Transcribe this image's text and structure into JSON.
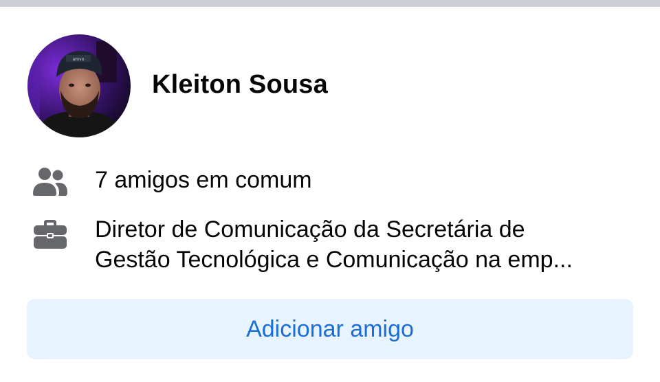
{
  "colors": {
    "divider": "#ccd0d5",
    "text_primary": "#050505",
    "icon_gray": "#65676b",
    "button_bg": "#e7f3ff",
    "button_text": "#1b6ed6"
  },
  "profile": {
    "name": "Kleiton Sousa",
    "avatar_icon": "profile-photo"
  },
  "info": {
    "mutual_friends": {
      "icon": "people-icon",
      "text": "7 amigos em comum"
    },
    "work": {
      "icon": "briefcase-icon",
      "line1": "Diretor de Comunicação da Secretária de",
      "line2": "Gestão Tecnológica e Comunicação na emp..."
    }
  },
  "actions": {
    "add_friend_label": "Adicionar amigo"
  }
}
